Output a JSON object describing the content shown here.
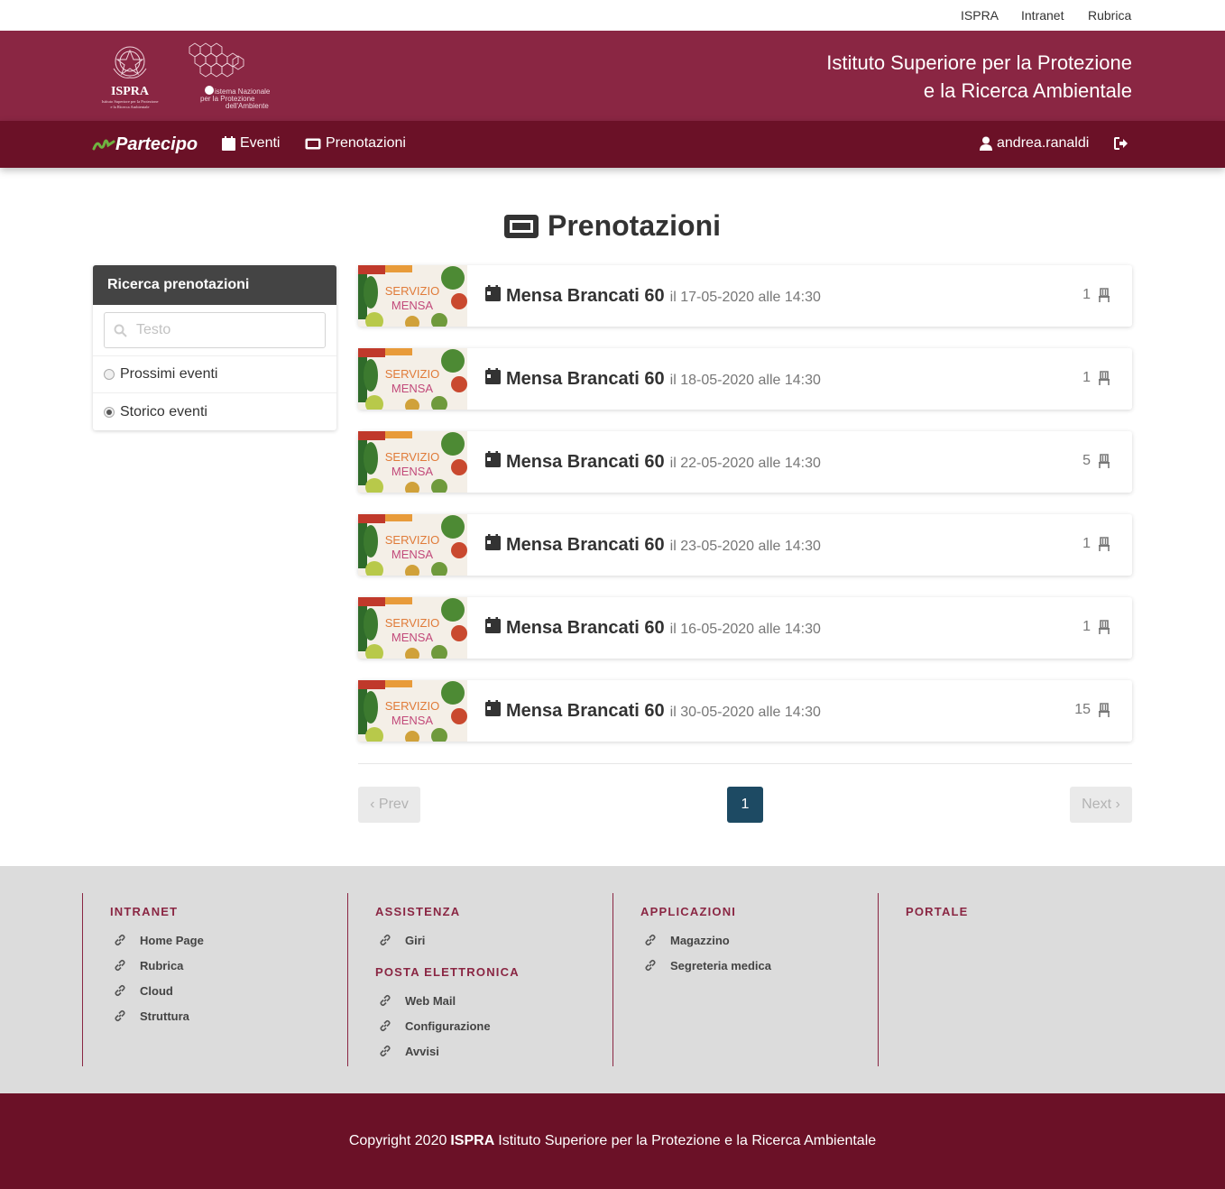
{
  "topbar": {
    "links": [
      "ISPRA",
      "Intranet",
      "Rubrica"
    ]
  },
  "header": {
    "logo_ispra_text": "ISPRA",
    "logo_ispra_sub": "Istituto Superiore per la Protezione e la Ricerca Ambientale",
    "logo_snpa_text": "Sistema Nazionale per la Protezione dell'Ambiente",
    "title_line1": "Istituto Superiore per la Protezione",
    "title_line2": "e la Ricerca Ambientale"
  },
  "navbar": {
    "brand": "Partecipo",
    "items": [
      "Eventi",
      "Prenotazioni"
    ],
    "user": "andrea.ranaldi"
  },
  "page": {
    "title": "Prenotazioni"
  },
  "sidebar": {
    "title": "Ricerca prenotazioni",
    "search_placeholder": "Testo",
    "filters": [
      {
        "label": "Prossimi eventi",
        "checked": false
      },
      {
        "label": "Storico eventi",
        "checked": true
      }
    ]
  },
  "bookings": [
    {
      "title": "Mensa Brancati 60",
      "date": "il 17-05-2020 alle 14:30",
      "count": "1"
    },
    {
      "title": "Mensa Brancati 60",
      "date": "il 18-05-2020 alle 14:30",
      "count": "1"
    },
    {
      "title": "Mensa Brancati 60",
      "date": "il 22-05-2020 alle 14:30",
      "count": "5"
    },
    {
      "title": "Mensa Brancati 60",
      "date": "il 23-05-2020 alle 14:30",
      "count": "1"
    },
    {
      "title": "Mensa Brancati 60",
      "date": "il 16-05-2020 alle 14:30",
      "count": "1"
    },
    {
      "title": "Mensa Brancati 60",
      "date": "il 30-05-2020 alle 14:30",
      "count": "15"
    }
  ],
  "thumbnail_text": [
    "SERVIZIO",
    "MENSA"
  ],
  "pagination": {
    "prev": "‹ Prev",
    "current": "1",
    "next": "Next ›"
  },
  "footer": {
    "intranet": {
      "title": "INTRANET",
      "links": [
        "Home Page",
        "Rubrica",
        "Cloud",
        "Struttura"
      ]
    },
    "assistenza": {
      "title": "ASSISTENZA",
      "links": [
        "Giri"
      ]
    },
    "posta": {
      "title": "POSTA ELETTRONICA",
      "links": [
        "Web Mail",
        "Configurazione",
        "Avvisi"
      ]
    },
    "applicazioni": {
      "title": "APPLICAZIONI",
      "links": [
        "Magazzino",
        "Segreteria medica"
      ]
    },
    "portale": {
      "title": "PORTALE"
    }
  },
  "copyright": {
    "prefix": "Copyright 2020",
    "org": "ISPRA",
    "suffix": "Istituto Superiore per la Protezione e la Ricerca Ambientale"
  },
  "colors": {
    "brand": "#8a2643",
    "nav": "#6b1127",
    "page_active": "#1d4a63",
    "footer_bg": "#dcdcdc"
  }
}
